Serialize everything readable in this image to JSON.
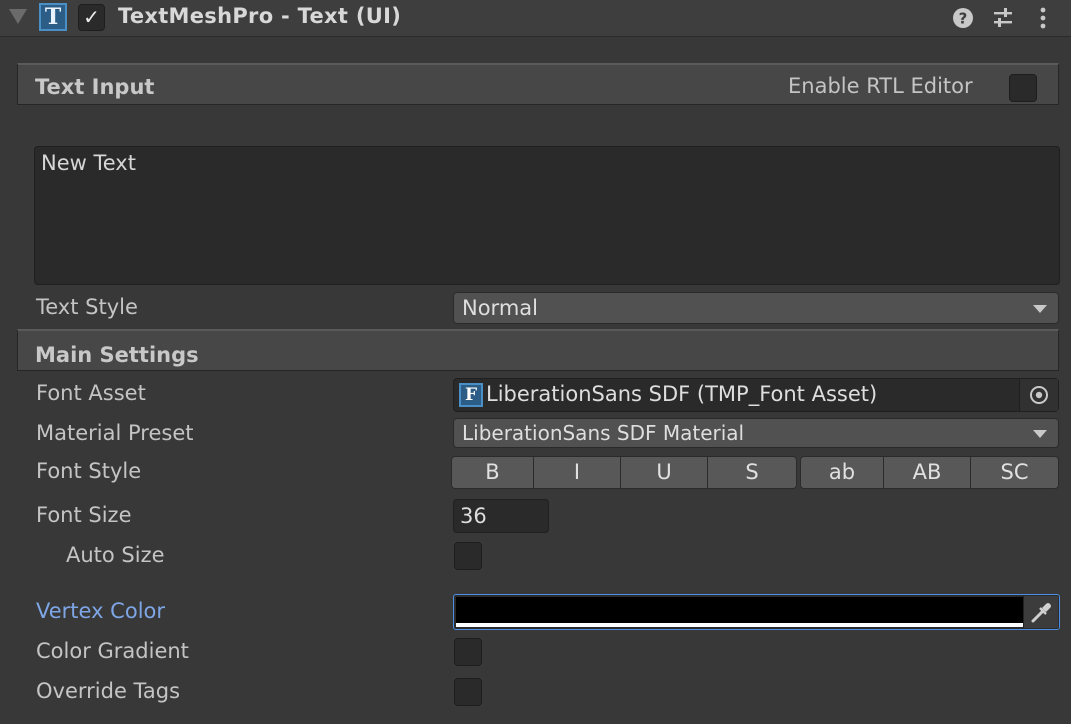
{
  "header": {
    "title": "TextMeshPro - Text (UI)",
    "icon_letter": "T",
    "enabled_mark": "✓"
  },
  "text_input": {
    "section_title": "Text Input",
    "rtl_label": "Enable RTL Editor",
    "text_value": "New Text",
    "text_style_label": "Text Style",
    "text_style_value": "Normal"
  },
  "main_settings": {
    "section_title": "Main Settings",
    "font_asset_label": "Font Asset",
    "font_asset_icon_letter": "F",
    "font_asset_value": "LiberationSans SDF (TMP_Font Asset)",
    "material_preset_label": "Material Preset",
    "material_preset_value": "LiberationSans SDF Material",
    "font_style_label": "Font Style",
    "font_style_buttons": [
      "B",
      "I",
      "U",
      "S",
      "ab",
      "AB",
      "SC"
    ],
    "font_size_label": "Font Size",
    "font_size_value": "36",
    "auto_size_label": "Auto Size",
    "vertex_color_label": "Vertex Color",
    "vertex_color_value": "#000000",
    "color_gradient_label": "Color Gradient",
    "override_tags_label": "Override Tags"
  },
  "colors": {
    "accent_blue": "#7ea6e6",
    "focus_border": "#4d8ee6"
  },
  "icons": {
    "help": "question-circle-icon",
    "presets": "sliders-icon",
    "menu": "kebab-menu-icon",
    "eyedropper": "eyedropper-icon",
    "object_picker": "target-circle-icon"
  }
}
